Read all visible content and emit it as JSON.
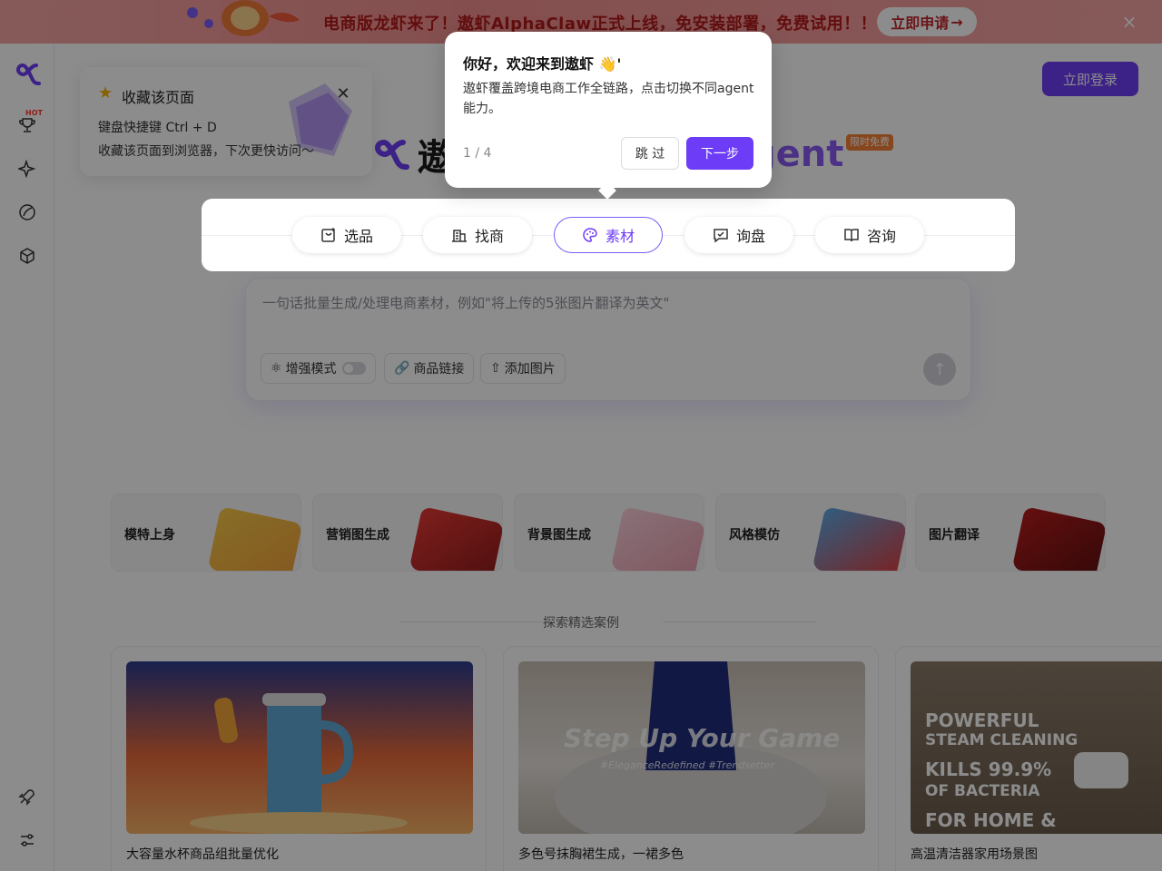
{
  "banner": {
    "text": "电商版龙虾来了！遨虾AlphaClaw正式上线，免安装部署，免费试用！！",
    "cta_label": "立即申请",
    "cta_arrow": "→",
    "close_icon": "×",
    "bg_color": "#f28f8f"
  },
  "sidebar": {
    "hot_badge": "HOT",
    "items": [
      {
        "icon": "trophy-icon"
      },
      {
        "icon": "sparkle-icon"
      },
      {
        "icon": "leaf-icon"
      },
      {
        "icon": "cube-icon"
      },
      {
        "icon": "rocket-icon"
      },
      {
        "icon": "settings-sliders-icon"
      }
    ]
  },
  "header": {
    "login_label": "立即登录",
    "brand_left": "遨",
    "brand_right": "gent",
    "free_badge": "限时免费",
    "accent": "#6d3cf6"
  },
  "bookmark": {
    "title": "收藏该页面",
    "shortcut": "键盘快捷键  Ctrl + D",
    "hint": "收藏该页面到浏览器，下次更快访问～"
  },
  "tabs": [
    {
      "label": "选品",
      "icon": "select-product-icon",
      "active": false
    },
    {
      "label": "找商",
      "icon": "building-icon",
      "active": false
    },
    {
      "label": "素材",
      "icon": "palette-icon",
      "active": true
    },
    {
      "label": "询盘",
      "icon": "message-icon",
      "active": false
    },
    {
      "label": "咨询",
      "icon": "book-icon",
      "active": false
    }
  ],
  "prompt": {
    "placeholder": "一句话批量生成/处理电商素材，例如\"将上传的5张图片翻译为英文\"",
    "enhanced_label": "增强模式",
    "enhanced_on": false,
    "link_label": "商品链接",
    "upload_label": "添加图片"
  },
  "features": [
    {
      "label": "模特上身"
    },
    {
      "label": "营销图生成"
    },
    {
      "label": "背景图生成"
    },
    {
      "label": "风格模仿"
    },
    {
      "label": "图片翻译"
    }
  ],
  "cases_title": "探索精选案例",
  "cases": [
    {
      "caption": "大容量水杯商品组批量优化"
    },
    {
      "caption": "多色号抹胸裙生成，一裙多色",
      "overlay_title": "Step Up Your Game",
      "overlay_tags": "#EleganceRedefined #Trendsetter"
    },
    {
      "caption": "高温清洁器家用场景图",
      "overlay_lines": [
        "POWERFUL",
        "STEAM CLEANING",
        "KILLS 99.9%",
        "OF BACTERIA",
        "FOR HOME &"
      ]
    }
  ],
  "tour": {
    "title": "你好，欢迎来到遨虾 👋'",
    "desc": "遨虾覆盖跨境电商工作全链路，点击切换不同agent能力。",
    "step": "1 / 4",
    "skip_label": "跳 过",
    "next_label": "下一步"
  }
}
